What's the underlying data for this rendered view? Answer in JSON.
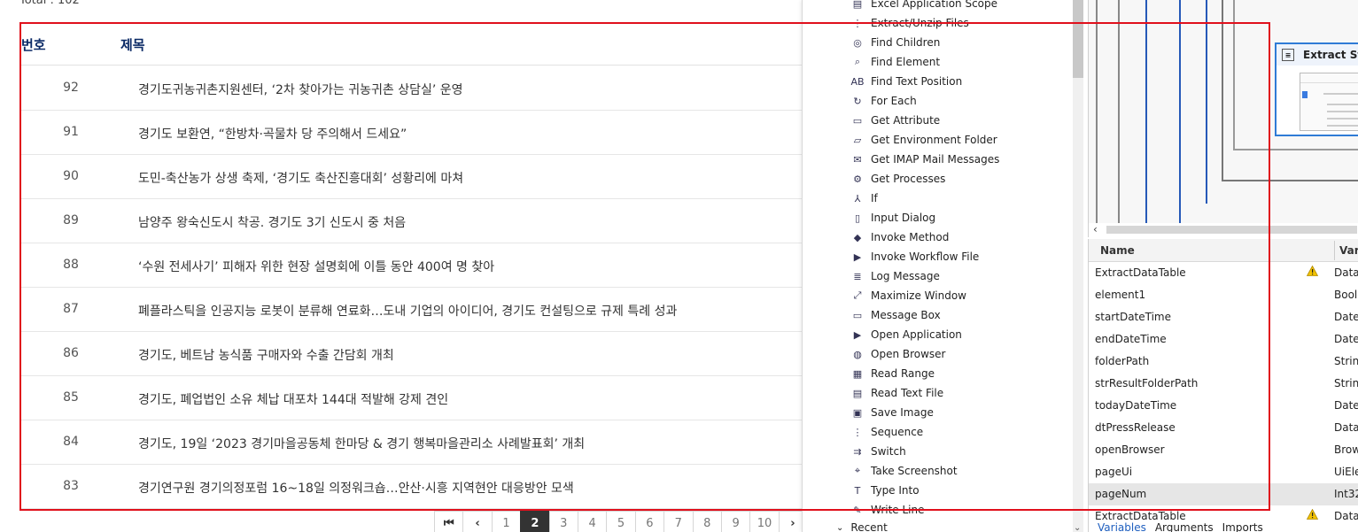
{
  "web": {
    "total_label": "Total : 102",
    "header": {
      "num": "번호",
      "title": "제목"
    },
    "rows": [
      {
        "num": "92",
        "title": "경기도귀농귀촌지원센터, ‘2차 찾아가는 귀농귀촌 상담실’ 운영"
      },
      {
        "num": "91",
        "title": "경기도 보환연, “한방차·곡물차 당 주의해서 드세요”"
      },
      {
        "num": "90",
        "title": "도민-축산농가 상생 축제, ‘경기도 축산진흥대회’ 성황리에 마쳐"
      },
      {
        "num": "89",
        "title": "남양주 왕숙신도시 착공. 경기도 3기 신도시 중 처음"
      },
      {
        "num": "88",
        "title": "‘수원 전세사기’ 피해자 위한 현장 설명회에 이틀 동안 400여 명 찾아"
      },
      {
        "num": "87",
        "title": "폐플라스틱을 인공지능 로봇이 분류해 연료화…도내 기업의 아이디어, 경기도 컨설팅으로 규제 특례 성과"
      },
      {
        "num": "86",
        "title": "경기도, 베트남 농식품 구매자와 수출 간담회 개최"
      },
      {
        "num": "85",
        "title": "경기도, 폐업법인 소유 체납 대포차 144대 적발해 강제 견인"
      },
      {
        "num": "84",
        "title": "경기도, 19일 ‘2023 경기마을공동체 한마당 & 경기 행복마을관리소 사례발표회’ 개최"
      },
      {
        "num": "83",
        "title": "경기연구원 경기의정포럼 16~18일 의정워크숍…안산·시흥 지역현안 대응방안 모색"
      }
    ],
    "pager": {
      "first": "⏮",
      "prev": "‹",
      "pages": [
        "1",
        "2",
        "3",
        "4",
        "5",
        "6",
        "7",
        "8",
        "9",
        "10"
      ],
      "active_page": "2",
      "next": "›"
    }
  },
  "activities": {
    "items": [
      {
        "label": "Excel Application Scope",
        "icon": "excel-icon"
      },
      {
        "label": "Extract/Unzip Files",
        "icon": "unzip-icon"
      },
      {
        "label": "Find Children",
        "icon": "find-children-icon"
      },
      {
        "label": "Find Element",
        "icon": "magnifier-icon"
      },
      {
        "label": "Find Text Position",
        "icon": "text-position-icon"
      },
      {
        "label": "For Each",
        "icon": "loop-icon"
      },
      {
        "label": "Get Attribute",
        "icon": "attribute-icon"
      },
      {
        "label": "Get Environment Folder",
        "icon": "folder-icon"
      },
      {
        "label": "Get IMAP Mail Messages",
        "icon": "mail-icon"
      },
      {
        "label": "Get Processes",
        "icon": "gears-icon"
      },
      {
        "label": "If",
        "icon": "branch-icon"
      },
      {
        "label": "Input Dialog",
        "icon": "dialog-icon"
      },
      {
        "label": "Invoke Method",
        "icon": "cube-icon"
      },
      {
        "label": "Invoke Workflow File",
        "icon": "play-icon"
      },
      {
        "label": "Log Message",
        "icon": "log-icon"
      },
      {
        "label": "Maximize Window",
        "icon": "maximize-icon"
      },
      {
        "label": "Message Box",
        "icon": "message-box-icon"
      },
      {
        "label": "Open Application",
        "icon": "play-icon"
      },
      {
        "label": "Open Browser",
        "icon": "globe-icon"
      },
      {
        "label": "Read Range",
        "icon": "excel-read-icon"
      },
      {
        "label": "Read Text File",
        "icon": "text-file-icon"
      },
      {
        "label": "Save Image",
        "icon": "image-icon"
      },
      {
        "label": "Sequence",
        "icon": "sequence-icon"
      },
      {
        "label": "Switch",
        "icon": "switch-icon"
      },
      {
        "label": "Take Screenshot",
        "icon": "screenshot-icon"
      },
      {
        "label": "Type Into",
        "icon": "type-into-icon"
      },
      {
        "label": "Write Line",
        "icon": "write-line-icon"
      }
    ],
    "recent_label": "Recent"
  },
  "designer": {
    "extract_title": "Extract Str"
  },
  "variables": {
    "headers": {
      "name": "Name",
      "type": "Vari"
    },
    "rows": [
      {
        "name": "ExtractDataTable",
        "type": "DataT",
        "warn": true
      },
      {
        "name": "element1",
        "type": "Boole"
      },
      {
        "name": "startDateTime",
        "type": "DateT"
      },
      {
        "name": "endDateTime",
        "type": "DateT"
      },
      {
        "name": "folderPath",
        "type": "String"
      },
      {
        "name": "strResultFolderPath",
        "type": "String"
      },
      {
        "name": "todayDateTime",
        "type": "DateT"
      },
      {
        "name": "dtPressRelease",
        "type": "DataT"
      },
      {
        "name": "openBrowser",
        "type": "Brow"
      },
      {
        "name": "pageUi",
        "type": "UiEle"
      },
      {
        "name": "pageNum",
        "type": "Int32",
        "selected": true
      },
      {
        "name": "ExtractDataTable",
        "type": "DataT",
        "warn": true
      }
    ],
    "tabs": [
      "Variables",
      "Arguments",
      "Imports"
    ]
  },
  "colors": {
    "highlight_box": "#e0101c",
    "header_text": "#0b2a66",
    "active_page_bg": "#333333",
    "designer_accent": "#2f7bd6"
  }
}
